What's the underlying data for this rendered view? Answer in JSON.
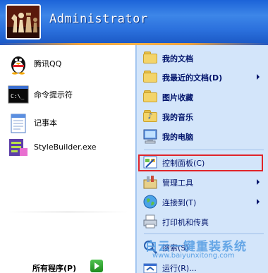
{
  "header": {
    "user_name": "Administrator"
  },
  "left_items": [
    {
      "label": "腾讯QQ",
      "icon": "qq-penguin-icon"
    },
    {
      "label": "命令提示符",
      "icon": "command-prompt-icon"
    },
    {
      "label": "记事本",
      "icon": "notepad-icon"
    },
    {
      "label": "StyleBuilder.exe",
      "icon": "stylebuilder-icon"
    }
  ],
  "all_programs": {
    "label": "所有程序(P)"
  },
  "right_items": [
    {
      "label": "我的文档",
      "icon": "my-documents-folder-icon"
    },
    {
      "label": "我最近的文档(D)",
      "icon": "recent-documents-folder-icon"
    },
    {
      "label": "图片收藏",
      "icon": "my-pictures-folder-icon"
    },
    {
      "label": "我的音乐",
      "icon": "my-music-folder-icon"
    },
    {
      "label": "我的电脑",
      "icon": "my-computer-icon"
    },
    {
      "label": "控制面板(C)",
      "icon": "control-panel-icon"
    },
    {
      "label": "管理工具",
      "icon": "admin-tools-icon"
    },
    {
      "label": "连接到(T)",
      "icon": "connect-to-globe-icon"
    },
    {
      "label": "打印机和传真",
      "icon": "printer-icon"
    },
    {
      "label": "搜索(S)",
      "icon": "search-icon"
    },
    {
      "label": "运行(R)...",
      "icon": "run-icon"
    }
  ],
  "watermark": {
    "title": "白云一键重装系统",
    "url": "www.baiyunxitong.com"
  },
  "colors": {
    "header_blue": "#2a6fdc",
    "right_pane_bg": "#d3e5fa",
    "highlight_red": "#e0242a"
  }
}
